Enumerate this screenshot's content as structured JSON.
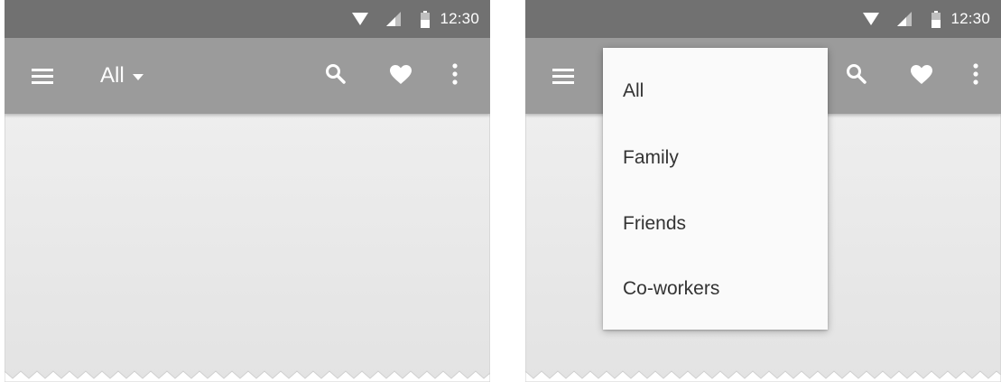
{
  "status_bar": {
    "time": "12:30"
  },
  "app_bar": {
    "spinner_selected": "All"
  },
  "dropdown": {
    "options": [
      "All",
      "Family",
      "Friends",
      "Co-workers"
    ]
  },
  "icons": {
    "status": [
      "wifi-icon",
      "signal-icon",
      "battery-icon"
    ],
    "app_bar": [
      "menu-icon",
      "chevron-down-icon",
      "search-icon",
      "heart-icon",
      "more-vert-icon"
    ]
  },
  "colors": {
    "status_bar": "#717171",
    "app_bar": "#9b9b9b",
    "content": "#e8e8e8",
    "menu_surface": "#fafafa",
    "menu_text": "#333333",
    "icon": "#ffffff"
  }
}
